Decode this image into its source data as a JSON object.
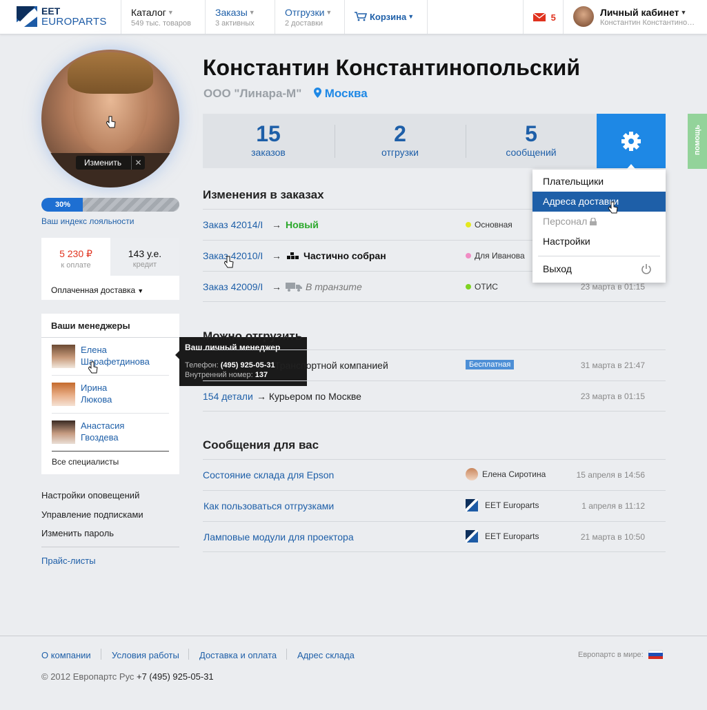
{
  "header": {
    "logo_top": "EET",
    "logo_bottom": "EUROPARTS",
    "nav": [
      {
        "title": "Каталог",
        "sub": "549 тыс. товаров"
      },
      {
        "title": "Заказы",
        "sub": "3 активных"
      },
      {
        "title": "Отгрузки",
        "sub": "2 доставки"
      },
      {
        "title": "Корзина",
        "sub": ""
      }
    ],
    "mail_count": "5",
    "account_title": "Личный кабинет",
    "account_sub": "Константин Константинопольский"
  },
  "profile": {
    "edit_label": "Изменить",
    "edit_close": "✕",
    "loyalty_percent": 30,
    "loyalty_text": "30%",
    "loyalty_link": "Ваш индекс лояльности",
    "to_pay_value": "5 230 ₽",
    "to_pay_label": "к оплате",
    "credit_value": "143 у.е.",
    "credit_label": "кредит",
    "delivery_select": "Оплаченная доставка"
  },
  "managers": {
    "title": "Ваши менеджеры",
    "items": [
      {
        "first": "Елена",
        "last": "Шарафетдинова"
      },
      {
        "first": "Ирина",
        "last": "Люкова"
      },
      {
        "first": "Анастасия",
        "last": "Гвоздева"
      }
    ],
    "all_link": "Все специалисты"
  },
  "tooltip": {
    "title": "Ваш личный менеджер",
    "phone_label": "Телефон:",
    "phone": "(495) 925-05-31",
    "ext_label": "Внутренний номер:",
    "ext": "137"
  },
  "side_links": [
    "Настройки оповещений",
    "Управление подписками",
    "Изменить пароль"
  ],
  "price_link": "Прайс-листы",
  "user": {
    "name": "Константин Константинопольский",
    "company": "ООО \"Линара-М\"",
    "city": "Москва"
  },
  "stats": [
    {
      "value": "15",
      "label": "заказов"
    },
    {
      "value": "2",
      "label": "отгрузки"
    },
    {
      "value": "5",
      "label": "сообщений"
    }
  ],
  "menu": {
    "items": [
      "Плательщики",
      "Адреса доставки",
      "Персонал",
      "Настройки"
    ],
    "logout": "Выход"
  },
  "orders": {
    "title": "Изменения в заказах",
    "rows": [
      {
        "order": "Заказ 42014/I",
        "status": "Новый",
        "tag": "Основная",
        "tag_color": "#e4e81e",
        "date": ""
      },
      {
        "order": "Заказ 42010/I",
        "status": "Частично собран",
        "tag": "Для Иванова",
        "tag_color": "#f08cc4",
        "date": ""
      },
      {
        "order": "Заказ 42009/I",
        "status": "В транзите",
        "tag": "ОТИС",
        "tag_color": "#7ed321",
        "date": "23 марта в 01:15"
      }
    ]
  },
  "ship": {
    "title": "Можно отгрузить",
    "rows": [
      {
        "item": "",
        "arrow": "→",
        "method": "Транспортной компанией",
        "badge": "Бесплатная",
        "date": "31 марта в 21:47"
      },
      {
        "item": "154 детали",
        "arrow": "→",
        "method": "Курьером по Москве",
        "badge": "",
        "date": "23 марта в 01:15"
      }
    ]
  },
  "messages": {
    "title": "Сообщения для вас",
    "rows": [
      {
        "subject": "Состояние склада для Epson",
        "from": "Елена Сиротина",
        "date": "15 апреля в 14:56"
      },
      {
        "subject": "Как пользоваться отгрузками",
        "from": "EET Europarts",
        "date": "1 апреля в 11:12"
      },
      {
        "subject": "Ламповые модули для проектора",
        "from": "EET Europarts",
        "date": "21 марта в 10:50"
      }
    ]
  },
  "help_tab": "помощь",
  "footer": {
    "links": [
      "О компании",
      "Условия работы",
      "Доставка и оплата",
      "Адрес склада"
    ],
    "world_label": "Европартс в мире:",
    "copyright": "© 2012 Европартс Рус",
    "phone": "+7 (495) 925-05-31"
  },
  "colors": {
    "accent": "#1e5fa8",
    "gear": "#1e88e5",
    "price_red": "#e0321e",
    "new_green": "#2aa82a",
    "badge_blue": "#4d8fd6"
  }
}
